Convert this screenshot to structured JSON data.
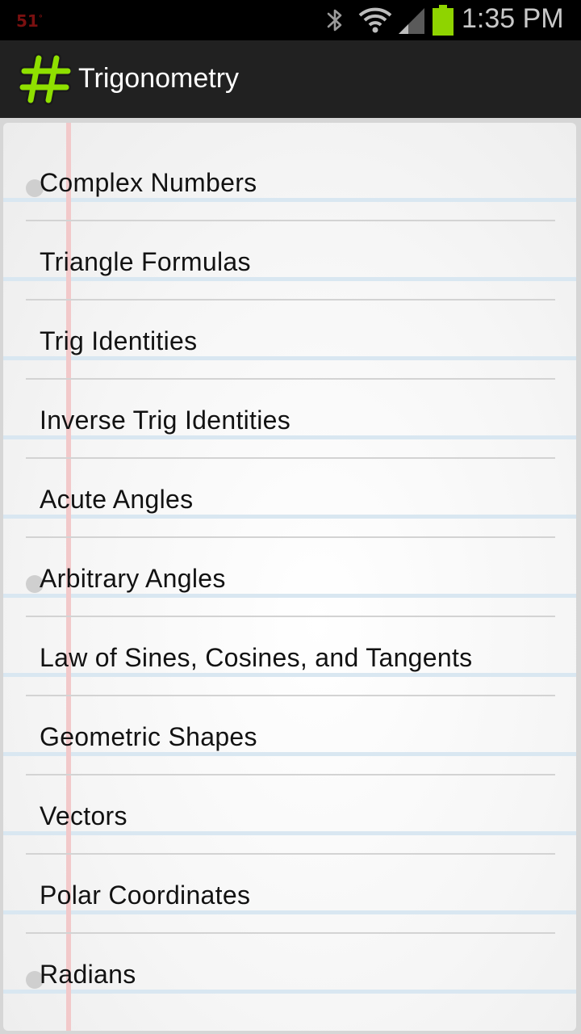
{
  "status_bar": {
    "temperature": "51",
    "temperature_unit": "°",
    "time": "1:35 PM",
    "icons": [
      "bluetooth-icon",
      "wifi-icon",
      "signal-icon",
      "battery-icon"
    ],
    "battery_color": "#8fd400",
    "temperature_color": "#7a1010"
  },
  "action_bar": {
    "icon": "hash-icon",
    "icon_color": "#8fe000",
    "title": "Trigonometry"
  },
  "topics": [
    {
      "label": "Complex Numbers",
      "hole": true
    },
    {
      "label": "Triangle Formulas",
      "hole": false
    },
    {
      "label": "Trig Identities",
      "hole": false
    },
    {
      "label": "Inverse Trig Identities",
      "hole": false
    },
    {
      "label": "Acute Angles",
      "hole": false
    },
    {
      "label": "Arbitrary Angles",
      "hole": true
    },
    {
      "label": "Law of Sines, Cosines, and Tangents",
      "hole": false
    },
    {
      "label": "Geometric Shapes",
      "hole": false
    },
    {
      "label": "Vectors",
      "hole": false
    },
    {
      "label": "Polar Coordinates",
      "hole": false
    },
    {
      "label": "Radians",
      "hole": true
    }
  ]
}
